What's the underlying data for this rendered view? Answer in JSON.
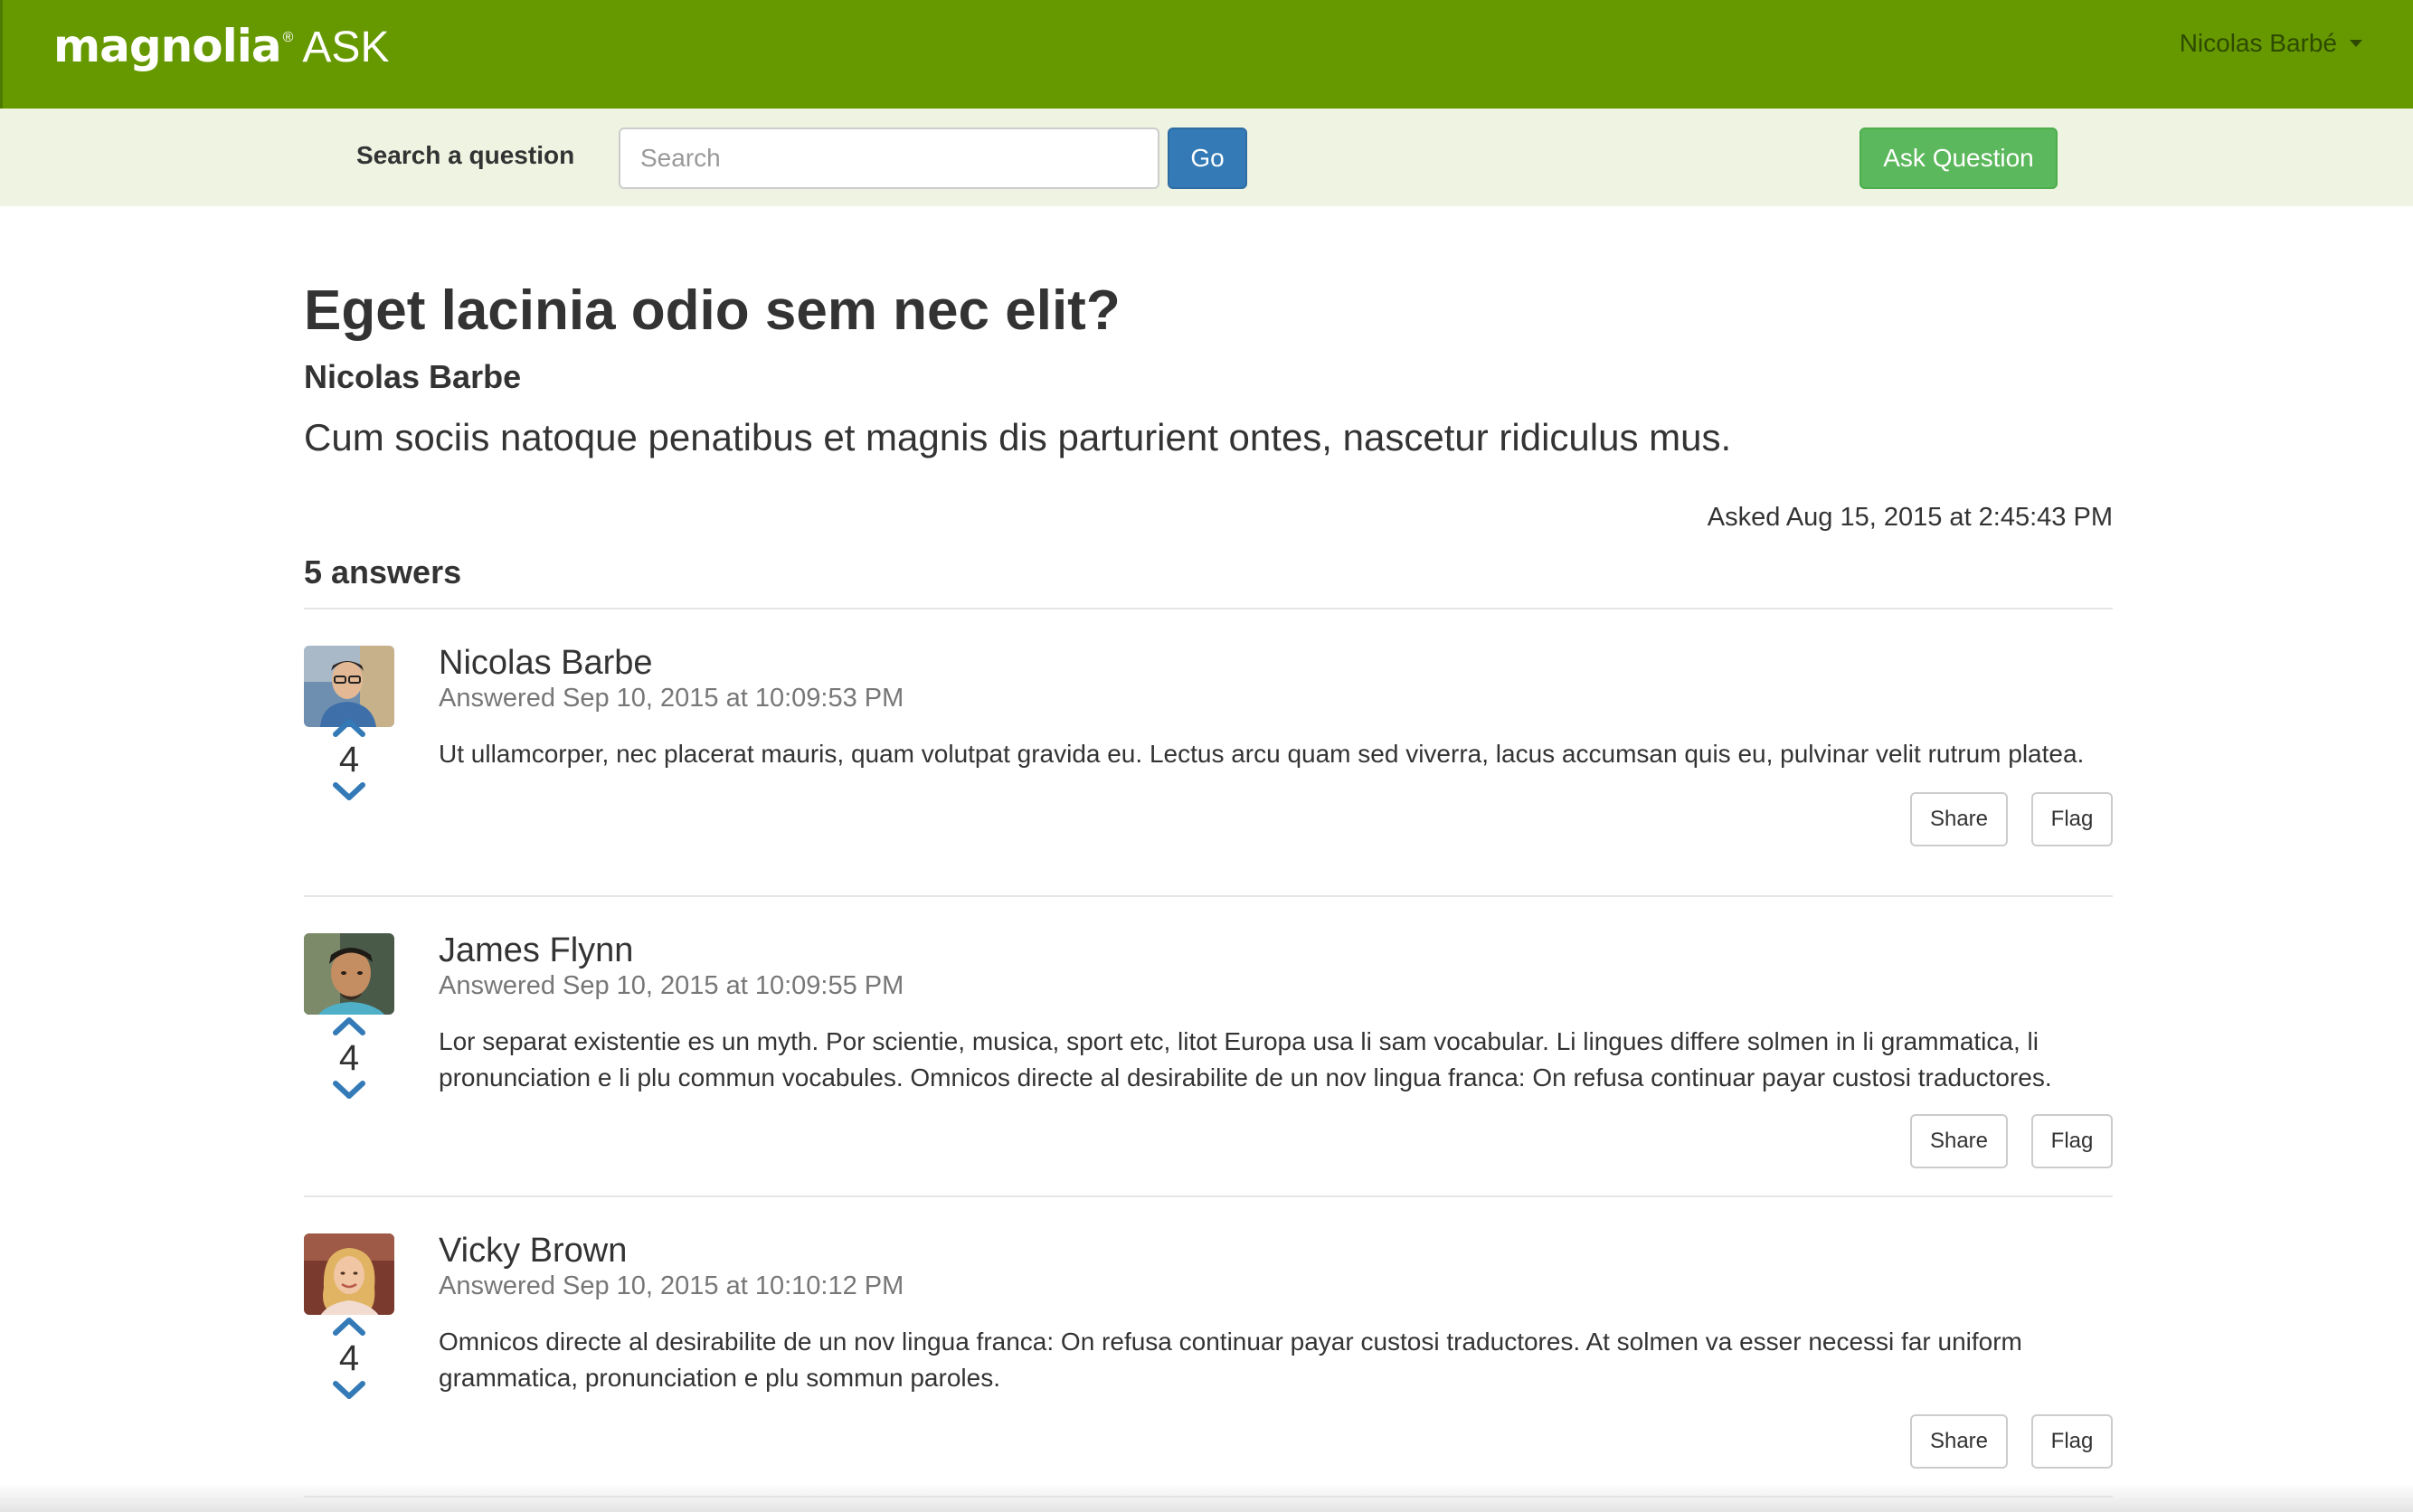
{
  "header": {
    "logo_word": "magnolia",
    "logo_reg": "®",
    "logo_app": "ASK",
    "user_name": "Nicolas Barbé"
  },
  "search": {
    "label": "Search a question",
    "placeholder": "Search",
    "value": "",
    "go_label": "Go",
    "ask_label": "Ask Question"
  },
  "question": {
    "title": "Eget lacinia odio sem nec elit?",
    "author": "Nicolas Barbe",
    "body": "Cum sociis natoque penatibus et magnis dis parturient ontes, nascetur ridiculus mus.",
    "asked": "Asked Aug 15, 2015 at 2:45:43 PM"
  },
  "answers_count": "5 answers",
  "answers": [
    {
      "author": "Nicolas Barbe",
      "date": "Answered Sep 10, 2015 at 10:09:53 PM",
      "body": "Ut ullamcorper, nec placerat mauris, quam volutpat gravida eu. Lectus arcu quam sed viverra, lacus accumsan quis eu, pulvinar velit rutrum platea.",
      "votes": "4",
      "share_label": "Share",
      "flag_label": "Flag"
    },
    {
      "author": "James Flynn",
      "date": "Answered Sep 10, 2015 at 10:09:55 PM",
      "body": "Lor separat existentie es un myth. Por scientie, musica, sport etc, litot Europa usa li sam vocabular. Li lingues differe solmen in li grammatica, li pronunciation e li plu commun vocabules. Omnicos directe al desirabilite de un nov lingua franca: On refusa continuar payar custosi traductores.",
      "votes": "4",
      "share_label": "Share",
      "flag_label": "Flag"
    },
    {
      "author": "Vicky Brown",
      "date": "Answered Sep 10, 2015 at 10:10:12 PM",
      "body": "Omnicos directe al desirabilite de un nov lingua franca: On refusa continuar payar custosi traductores. At solmen va esser necessi far uniform grammatica, pronunciation e plu sommun paroles.",
      "votes": "4",
      "share_label": "Share",
      "flag_label": "Flag"
    }
  ],
  "colors": {
    "navbar": "#669900",
    "searchbar": "#eef3e2",
    "primary": "#337ab7",
    "success": "#5cb85c",
    "vote_arrow": "#337ab7"
  },
  "icons": {
    "upvote": "chevron-up-icon",
    "downvote": "chevron-down-icon",
    "user_caret": "caret-down-icon"
  }
}
